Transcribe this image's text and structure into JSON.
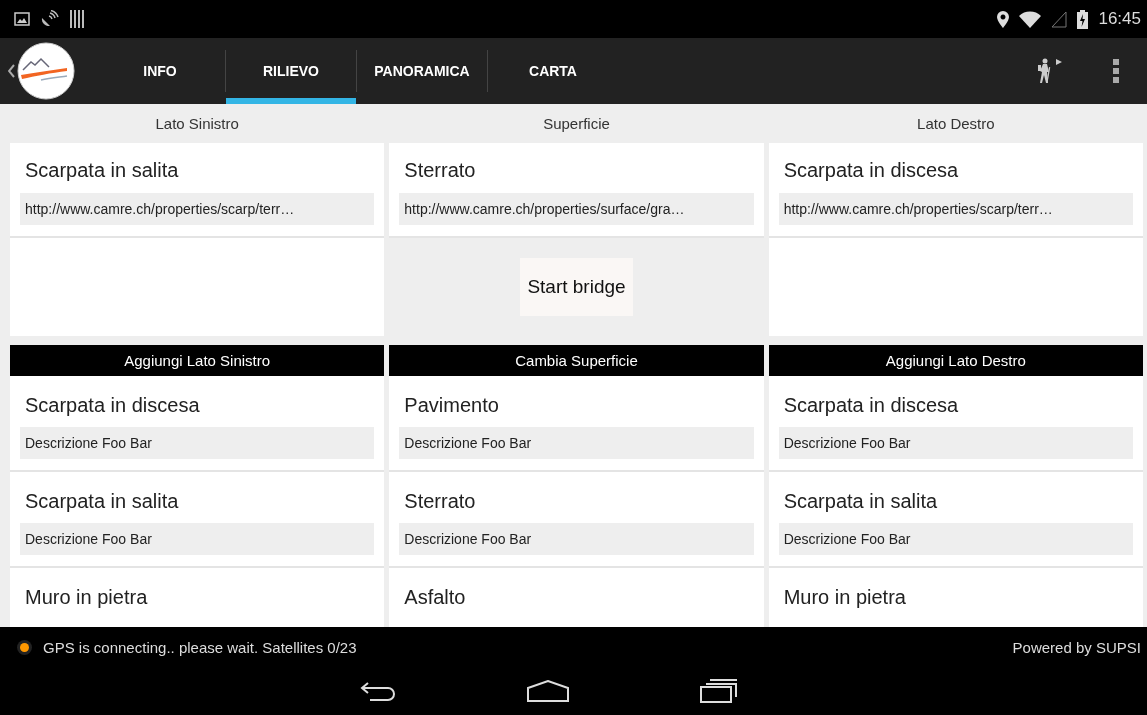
{
  "status_bar": {
    "time": "16:45"
  },
  "tabs": [
    {
      "label": "INFO",
      "selected": false
    },
    {
      "label": "RILIEVO",
      "selected": true
    },
    {
      "label": "PANORAMICA",
      "selected": false
    },
    {
      "label": "CARTA",
      "selected": false
    }
  ],
  "columns": [
    {
      "header": "Lato Sinistro",
      "current": {
        "title": "Scarpata in salita",
        "url": "http://www.camre.ch/properties/scarp/terr…"
      },
      "middle": {
        "kind": "empty"
      },
      "add_header": "Aggiungi Lato Sinistro",
      "options": [
        {
          "title": "Scarpata in discesa",
          "description": "Descrizione Foo Bar"
        },
        {
          "title": "Scarpata in salita",
          "description": "Descrizione Foo Bar"
        },
        {
          "title": "Muro in pietra"
        }
      ]
    },
    {
      "header": "Superficie",
      "current": {
        "title": "Sterrato",
        "url": "http://www.camre.ch/properties/surface/gra…"
      },
      "middle": {
        "kind": "button",
        "label": "Start bridge"
      },
      "add_header": "Cambia Superficie",
      "options": [
        {
          "title": "Pavimento",
          "description": "Descrizione Foo Bar"
        },
        {
          "title": "Sterrato",
          "description": "Descrizione Foo Bar"
        },
        {
          "title": "Asfalto"
        }
      ]
    },
    {
      "header": "Lato Destro",
      "current": {
        "title": "Scarpata in discesa",
        "url": "http://www.camre.ch/properties/scarp/terr…"
      },
      "middle": {
        "kind": "empty"
      },
      "add_header": "Aggiungi Lato Destro",
      "options": [
        {
          "title": "Scarpata in discesa",
          "description": "Descrizione Foo Bar"
        },
        {
          "title": "Scarpata in salita",
          "description": "Descrizione Foo Bar"
        },
        {
          "title": "Muro in pietra"
        }
      ]
    }
  ],
  "footer": {
    "gps_status": "GPS is connecting.. please wait. Satellites 0/23",
    "credit": "Powered by SUPSI"
  }
}
